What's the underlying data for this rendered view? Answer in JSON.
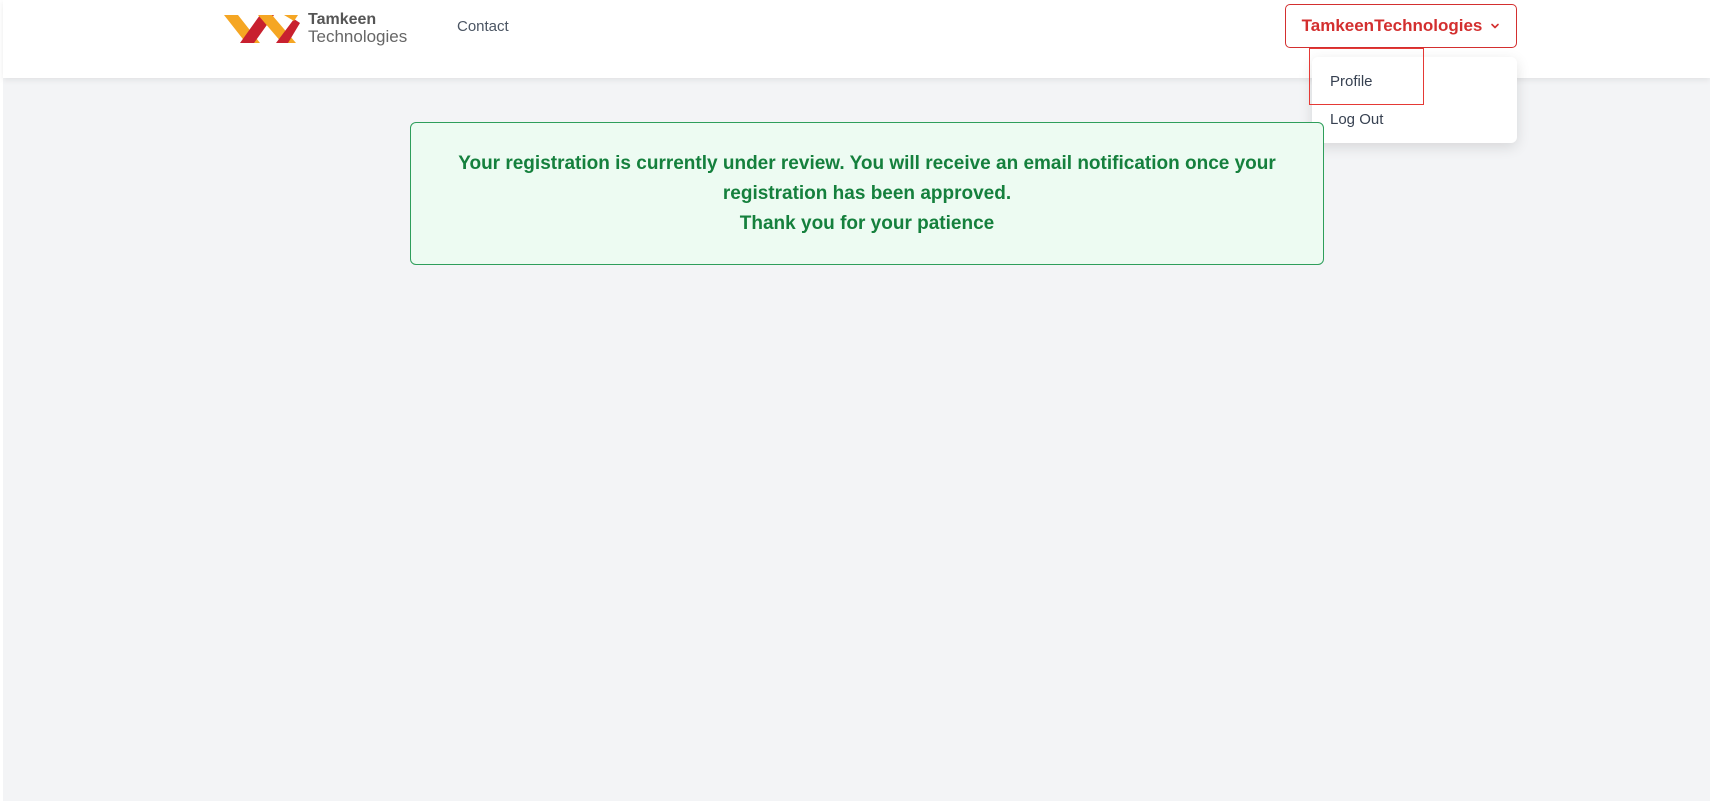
{
  "header": {
    "logo": {
      "name": "Tamkeen",
      "sub": "Technologies",
      "colors": {
        "orange": "#f5a623",
        "red": "#c8202f"
      }
    },
    "nav": {
      "contact_label": "Contact"
    },
    "user_menu": {
      "label": "TamkeenTechnologies",
      "icon": "chevron-down-icon",
      "items": [
        {
          "label": "Profile"
        },
        {
          "label": "Log Out"
        }
      ]
    }
  },
  "notice": {
    "line1": "Your registration is currently under review. You will receive an email notification once your",
    "line2": "registration has been approved.",
    "line3": "Thank you for your patience"
  },
  "colors": {
    "accent": "#d32f2f",
    "success_text": "#15803d",
    "success_bg": "#edfbf2",
    "page_bg": "#f3f4f6"
  }
}
